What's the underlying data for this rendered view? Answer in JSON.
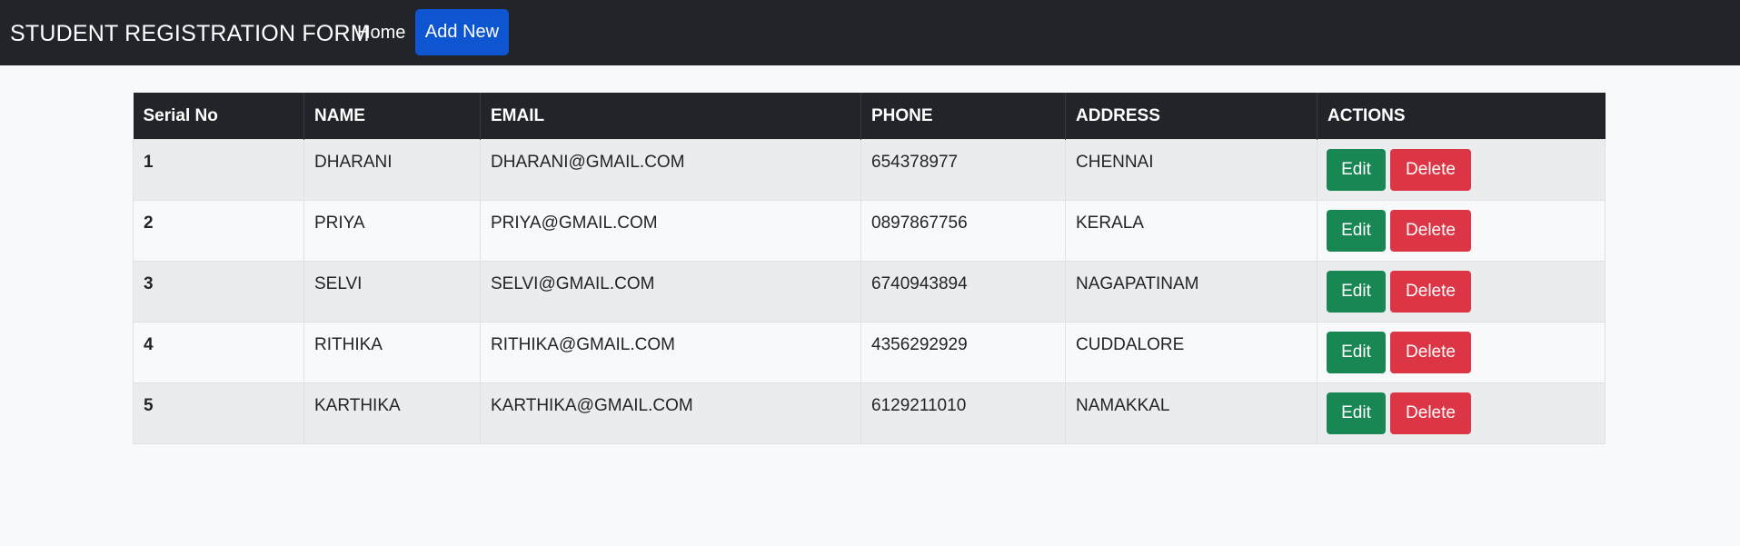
{
  "navbar": {
    "brand": "STUDENT REGISTRATION FORM",
    "home_label": "Home",
    "add_new_label": "Add New",
    "background": "#212529",
    "add_new_color": "#0d55d1"
  },
  "table": {
    "headers": [
      "Serial No",
      "NAME",
      "EMAIL",
      "PHONE",
      "ADDRESS",
      "ACTIONS"
    ],
    "rows": [
      {
        "serial": "1",
        "name": "DHARANI",
        "email": "DHARANI@GMAIL.COM",
        "phone": "654378977",
        "address": "CHENNAI"
      },
      {
        "serial": "2",
        "name": "PRIYA",
        "email": "PRIYA@GMAIL.COM",
        "phone": "0897867756",
        "address": "KERALA"
      },
      {
        "serial": "3",
        "name": "SELVI",
        "email": "SELVI@GMAIL.COM",
        "phone": "6740943894",
        "address": "NAGAPATINAM"
      },
      {
        "serial": "4",
        "name": "RITHIKA",
        "email": "RITHIKA@GMAIL.COM",
        "phone": "4356292929",
        "address": "CUDDALORE"
      },
      {
        "serial": "5",
        "name": "KARTHIKA",
        "email": "KARTHIKA@GMAIL.COM",
        "phone": "6129211010",
        "address": "NAMAKKAL"
      }
    ],
    "edit_label": "Edit",
    "delete_label": "Delete",
    "edit_color": "#198754",
    "delete_color": "#dc3545"
  }
}
